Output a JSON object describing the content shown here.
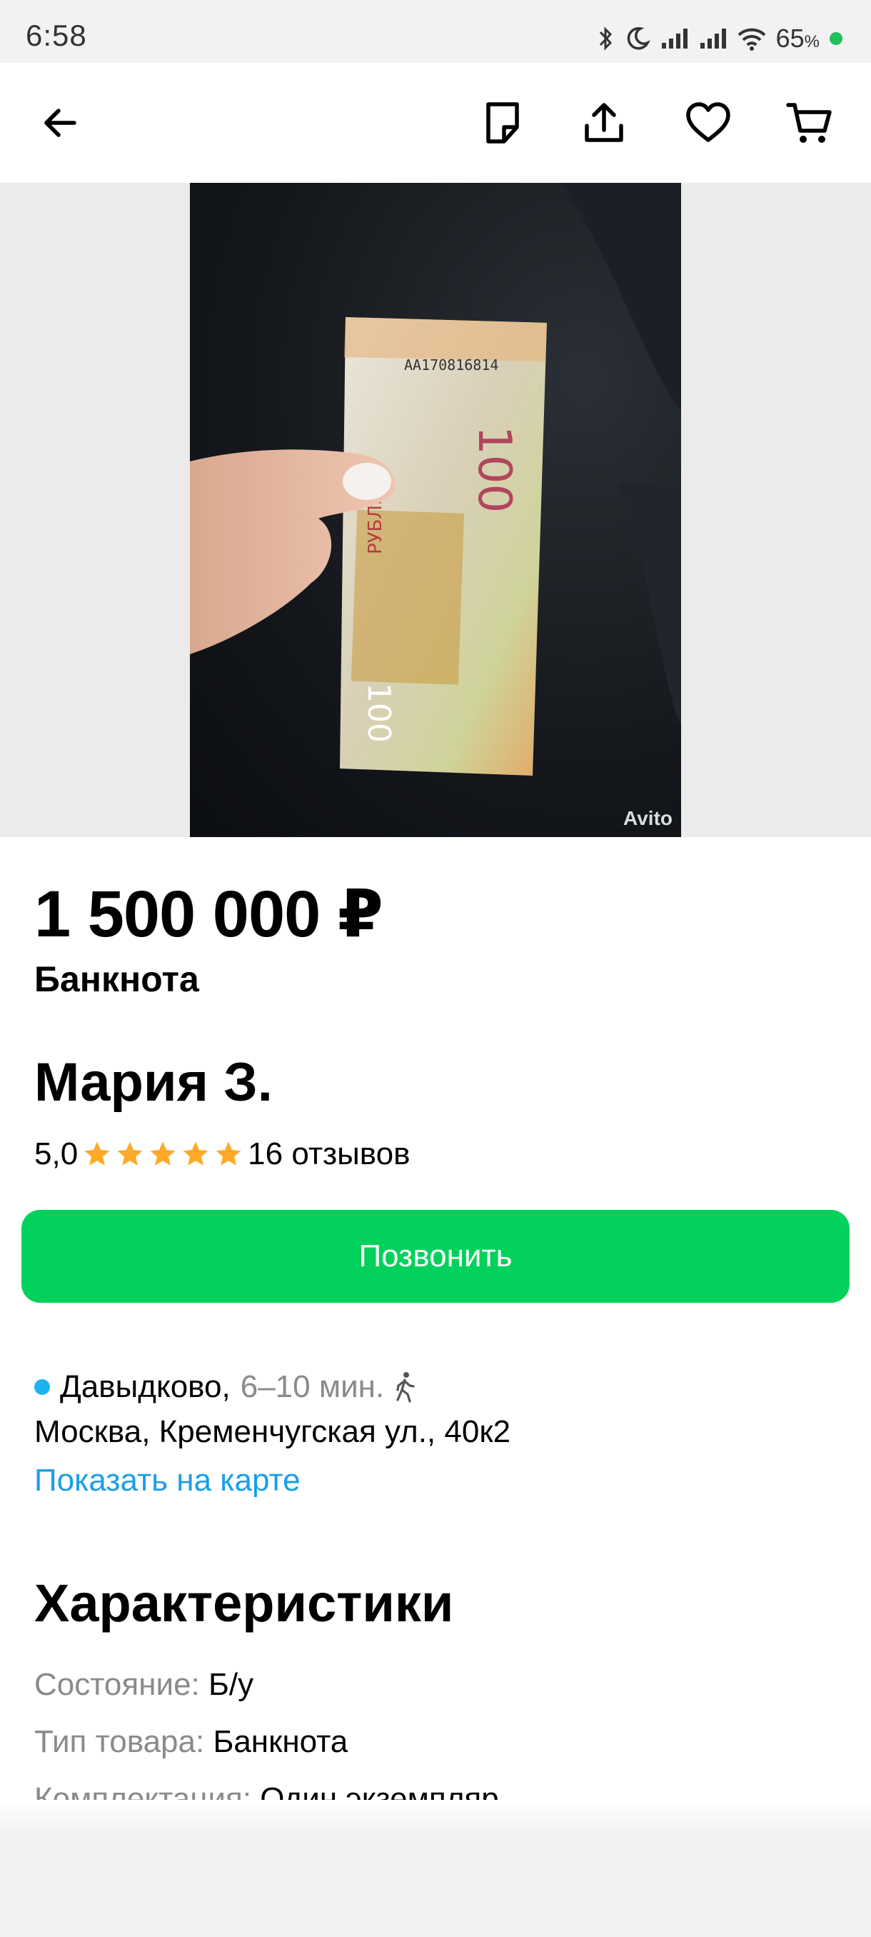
{
  "status_bar": {
    "time": "6:58",
    "battery_percent": "65",
    "battery_unit": "%",
    "icons": [
      "bluetooth-icon",
      "moon-icon",
      "signal-icon",
      "signal-icon",
      "wifi-icon"
    ]
  },
  "toolbar": {
    "icons": [
      "back-arrow-icon",
      "note-icon",
      "share-icon",
      "heart-icon",
      "cart-icon"
    ]
  },
  "photo": {
    "watermark": "Avito"
  },
  "listing": {
    "price": "1 500 000 ₽",
    "title": "Банкнота"
  },
  "seller": {
    "name": "Мария З.",
    "rating": "5,0",
    "stars": 5,
    "reviews": "16 отзывов"
  },
  "call_button": {
    "label": "Позвонить"
  },
  "location": {
    "metro": "Давыдково,",
    "walk_time": "6–10 мин.",
    "address": "Москва, Кременчугская ул., 40к2",
    "map_link": "Показать на карте"
  },
  "specs": {
    "title": "Характеристики",
    "rows": [
      {
        "key": "Состояние:",
        "value": "Б/у"
      },
      {
        "key": "Тип товара:",
        "value": "Банкнота"
      },
      {
        "key": "Комплектация:",
        "value": "Один экземпляр"
      }
    ]
  },
  "colors": {
    "accent_green": "#02d15c",
    "link_blue": "#1a9ee8",
    "star_orange": "#ffa928",
    "metro_blue": "#1db3f0"
  }
}
